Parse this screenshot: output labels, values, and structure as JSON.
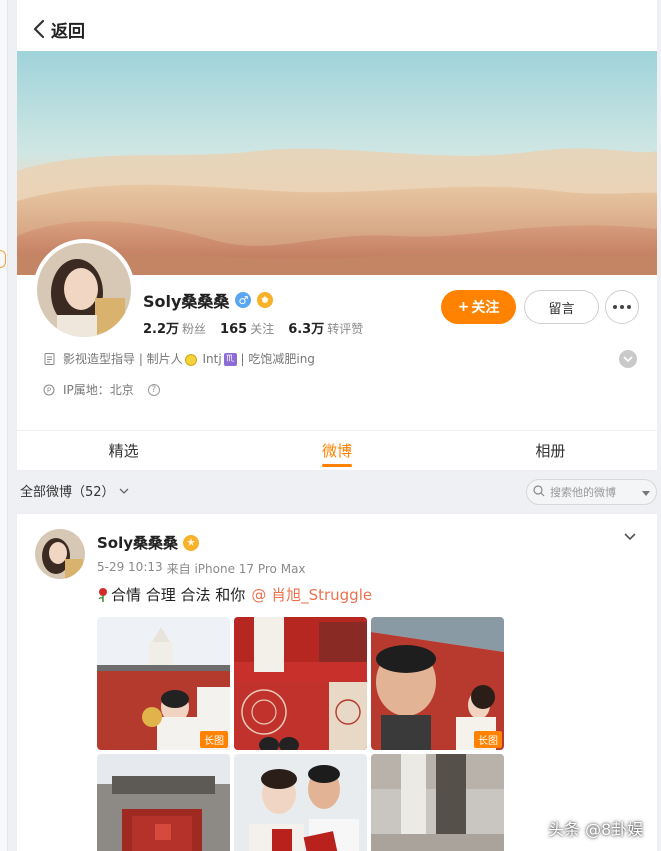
{
  "nav": {
    "back_label": "返回"
  },
  "profile": {
    "name": "Soly桑桑桑",
    "gender_symbol": "♂",
    "stats": [
      {
        "value": "2.2万",
        "label": "粉丝"
      },
      {
        "value": "165",
        "label": "关注"
      },
      {
        "value": "6.3万",
        "label": "转评赞"
      }
    ],
    "bio_prefix": "影视造型指导 | 制片人",
    "bio_middle": " Intj",
    "bio_suffix": " | 吃饱减肥ing",
    "ip_label": "IP属地：北京",
    "help_symbol": "?"
  },
  "actions": {
    "follow_plus": "+",
    "follow_label": "关注",
    "message_label": "留言"
  },
  "tabs": [
    {
      "label": "精选",
      "active": false
    },
    {
      "label": "微博",
      "active": true
    },
    {
      "label": "相册",
      "active": false
    }
  ],
  "filter": {
    "label": "全部微博（52）",
    "search_placeholder": "搜索他的微博"
  },
  "post": {
    "author": "Soly桑桑桑",
    "date": "5-29 10:13",
    "source": "来自 iPhone 17 Pro Max",
    "text": "合情 合理 合法 和你",
    "mention": "@ 肖旭_Struggle",
    "photos": [
      {
        "icon": "wedding-couple-photo",
        "long": true
      },
      {
        "icon": "red-door-wedding-photo",
        "long": false
      },
      {
        "icon": "selfie-wall-photo",
        "long": true
      },
      {
        "icon": "hutong-gate-photo",
        "long": false
      },
      {
        "icon": "marriage-certificate-photo",
        "long": false
      },
      {
        "icon": "walking-street-photo",
        "long": false
      }
    ],
    "long_tag": "长图"
  },
  "watermark": "头条 @8卦娱",
  "colors": {
    "accent": "#ff8200",
    "mention": "#eb7350",
    "verified_blue": "#5aa6f1",
    "vip_gold": "#f7b22a"
  }
}
